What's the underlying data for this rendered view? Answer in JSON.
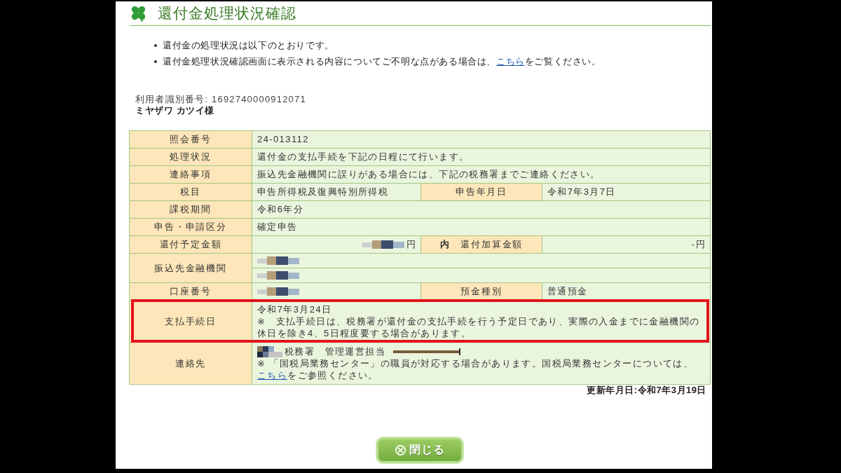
{
  "header": {
    "title": "還付金処理状況確認"
  },
  "notices": [
    {
      "parts": [
        {
          "kind": "text",
          "text": "還付金の処理状況は以下のとおりです。"
        }
      ]
    },
    {
      "parts": [
        {
          "kind": "text",
          "text": "還付金処理状況確認画面に表示される内容についてご不明な点がある場合は、"
        },
        {
          "kind": "link",
          "text": "こちら"
        },
        {
          "kind": "text",
          "text": "をご覧ください。"
        }
      ]
    }
  ],
  "user": {
    "id_line": "利用者識別番号: 1692740000912071",
    "name": "ミヤザワ カツイ様"
  },
  "table": {
    "rows": [
      {
        "label": "照会番号",
        "highlighted": false,
        "value": {
          "kind": "plain",
          "lines": [
            [
              {
                "kind": "text",
                "text": "24-013112"
              }
            ]
          ]
        }
      },
      {
        "label": "処理状況",
        "highlighted": false,
        "value": {
          "kind": "plain",
          "lines": [
            [
              {
                "kind": "text",
                "text": "還付金の支払手続を下記の日程にて行います。"
              }
            ]
          ]
        }
      },
      {
        "label": "連絡事項",
        "highlighted": false,
        "value": {
          "kind": "plain",
          "lines": [
            [
              {
                "kind": "text",
                "text": "振込先金融機関に誤りがある場合には、下記の税務署までご連絡ください。"
              }
            ]
          ]
        }
      },
      {
        "label": "税目",
        "highlighted": false,
        "value": {
          "kind": "plain",
          "lines": [
            [
              {
                "kind": "text",
                "text": "申告所得税及復興特別所得税"
              }
            ]
          ]
        },
        "label_2": "申告年月日",
        "value_2": {
          "kind": "plain",
          "lines": [
            [
              {
                "kind": "text",
                "text": "令和7年3月7日"
              }
            ]
          ]
        }
      },
      {
        "label": "課税期間",
        "highlighted": false,
        "value": {
          "kind": "plain",
          "lines": [
            [
              {
                "kind": "text",
                "text": "令和6年分"
              }
            ]
          ]
        }
      },
      {
        "label": "申告・申請区分",
        "highlighted": false,
        "value": {
          "kind": "plain",
          "lines": [
            [
              {
                "kind": "text",
                "text": "確定申告"
              }
            ]
          ]
        }
      },
      {
        "label": "還付予定金額",
        "highlighted": false,
        "value": {
          "kind": "amount",
          "lines": [
            [
              {
                "kind": "mosaic"
              },
              {
                "kind": "text",
                "text": "円"
              }
            ]
          ]
        },
        "label_2": "**内**　還付加算金額",
        "value_2": {
          "kind": "amount",
          "lines": [
            [
              {
                "kind": "text",
                "text": "-円"
              }
            ]
          ]
        }
      },
      {
        "label": "振込先金融機関",
        "highlighted": false,
        "value": {
          "kind": "split",
          "lines": [
            [
              {
                "kind": "mosaic"
              }
            ],
            [
              {
                "kind": "mosaic"
              }
            ]
          ]
        }
      },
      {
        "label": "口座番号",
        "highlighted": false,
        "value": {
          "kind": "plain",
          "lines": [
            [
              {
                "kind": "mosaic"
              }
            ]
          ]
        },
        "label_2": "預金種別",
        "value_2": {
          "kind": "plain",
          "lines": [
            [
              {
                "kind": "text",
                "text": "普通預金"
              }
            ]
          ]
        }
      },
      {
        "label": "支払手続日",
        "highlighted": true,
        "value": {
          "kind": "plain",
          "lines": [
            [
              {
                "kind": "text",
                "text": "令和7年3月24日"
              }
            ],
            [
              {
                "kind": "text",
                "text": "※　支払手続日は、税務署が還付金の支払手続を行う予定日であり、実際の入金までに金融機関の休日を除き4、5日程度要する場合があります。"
              }
            ]
          ]
        }
      },
      {
        "label": "連絡先",
        "highlighted": false,
        "value": {
          "kind": "plain",
          "lines": [
            [
              {
                "kind": "mosaic_short"
              },
              {
                "kind": "text",
                "text": "税務署　管理運営担当"
              },
              {
                "kind": "line"
              }
            ],
            [
              {
                "kind": "text",
                "text": "※ 「国税局業務センター」の職員が対応する場合があります。国税局業務センターについては、"
              },
              {
                "kind": "link",
                "text": "こちら"
              },
              {
                "kind": "text",
                "text": "をご参照ください。"
              }
            ]
          ]
        }
      }
    ]
  },
  "updated": "更新年月日:令和7年3月19日",
  "buttons": [
    {
      "kind": "close",
      "label": "閉じる"
    }
  ]
}
